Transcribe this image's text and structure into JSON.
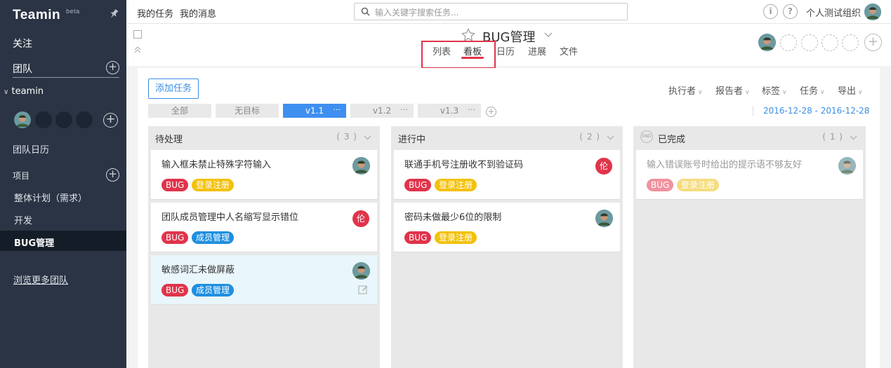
{
  "app": {
    "name": "Teamin",
    "badge": "beta"
  },
  "sidebar": {
    "follow": "关注",
    "team_section": "团队",
    "team_name": "teamin",
    "team_calendar": "团队日历",
    "projects_label": "项目",
    "projects": [
      {
        "label": "整体计划（需求）"
      },
      {
        "label": "开发"
      },
      {
        "label": "BUG管理"
      }
    ],
    "browse_more": "浏览更多团队"
  },
  "topbar": {
    "my_tasks": "我的任务",
    "my_messages": "我的消息",
    "search_placeholder": "输入关键字搜索任务...",
    "info_icon": "i",
    "help_icon": "?",
    "org_name": "个人测试组织"
  },
  "project": {
    "title": "BUG管理",
    "tabs": [
      {
        "label": "列表"
      },
      {
        "label": "看板"
      },
      {
        "label": "日历"
      },
      {
        "label": "进展"
      },
      {
        "label": "文件"
      }
    ],
    "active_tab": "看板"
  },
  "toolbar": {
    "add_task": "添加任务",
    "filters": [
      {
        "label": "执行者"
      },
      {
        "label": "报告者"
      },
      {
        "label": "标签"
      },
      {
        "label": "任务"
      },
      {
        "label": "导出"
      }
    ],
    "milestones": [
      {
        "label": "全部"
      },
      {
        "label": "无目标"
      },
      {
        "label": "v1.1"
      },
      {
        "label": "v1.2"
      },
      {
        "label": "v1.3"
      }
    ],
    "milestone_more": "···",
    "active_milestone": "v1.1",
    "date_range": "2016-12-28 - 2016-12-28"
  },
  "board": {
    "columns": [
      {
        "title": "待处理",
        "count": "( 3 )",
        "cards": [
          {
            "title": "输入框未禁止特殊字符输入",
            "tags": [
              "BUG",
              "登录注册"
            ]
          },
          {
            "title": "团队成员管理中人名缩写显示错位",
            "tags": [
              "BUG",
              "成员管理"
            ],
            "assignee": "伦"
          },
          {
            "title": "敏感词汇未做屏蔽",
            "tags": [
              "BUG",
              "成员管理"
            ]
          }
        ]
      },
      {
        "title": "进行中",
        "count": "( 2 )",
        "cards": [
          {
            "title": "联通手机号注册收不到验证码",
            "tags": [
              "BUG",
              "登录注册"
            ],
            "assignee": "伦"
          },
          {
            "title": "密码未做最少6位的限制",
            "tags": [
              "BUG",
              "登录注册"
            ]
          }
        ]
      },
      {
        "title": "已完成",
        "count": "( 1 )",
        "end_badge": "END",
        "cards": [
          {
            "title": "输入错误账号时给出的提示语不够友好",
            "tags": [
              "BUG",
              "登录注册"
            ]
          }
        ]
      }
    ]
  },
  "colors": {
    "sidebar_bg": "#2a3444",
    "accent_blue": "#3f8ff0",
    "bug_red": "#e0344b",
    "login_yellow": "#f3c10a",
    "member_blue": "#1e8fe0"
  }
}
